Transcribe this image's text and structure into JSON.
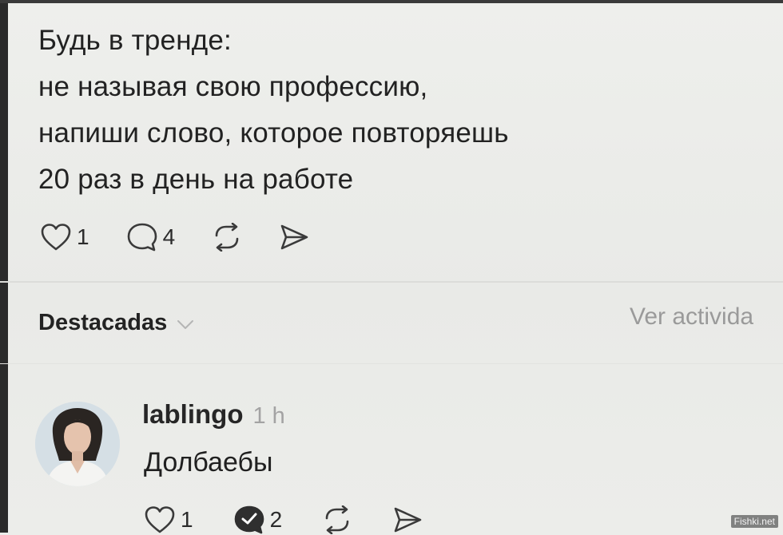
{
  "post": {
    "lines": [
      "Будь в тренде:",
      "не называя свою профессию,",
      "напиши слово, которое повторяешь",
      "20 раз в день на работе"
    ],
    "actions": {
      "like_count": "1",
      "comment_count": "4"
    }
  },
  "section": {
    "label": "Destacadas",
    "view_activity": "Ver activida"
  },
  "reply": {
    "username": "lablingo",
    "timestamp": "1 h",
    "text": "Долбаебы",
    "actions": {
      "like_count": "1",
      "comment_count": "2"
    }
  },
  "icons": {
    "like": "heart-icon",
    "comment": "speech-bubble-icon",
    "repost": "repost-icon",
    "share": "send-icon",
    "dropdown": "chevron-down-icon"
  },
  "watermark": "Fishki.net",
  "colors": {
    "background": "#ecedea",
    "text": "#1e1e1e",
    "muted": "#9a9a9a"
  }
}
